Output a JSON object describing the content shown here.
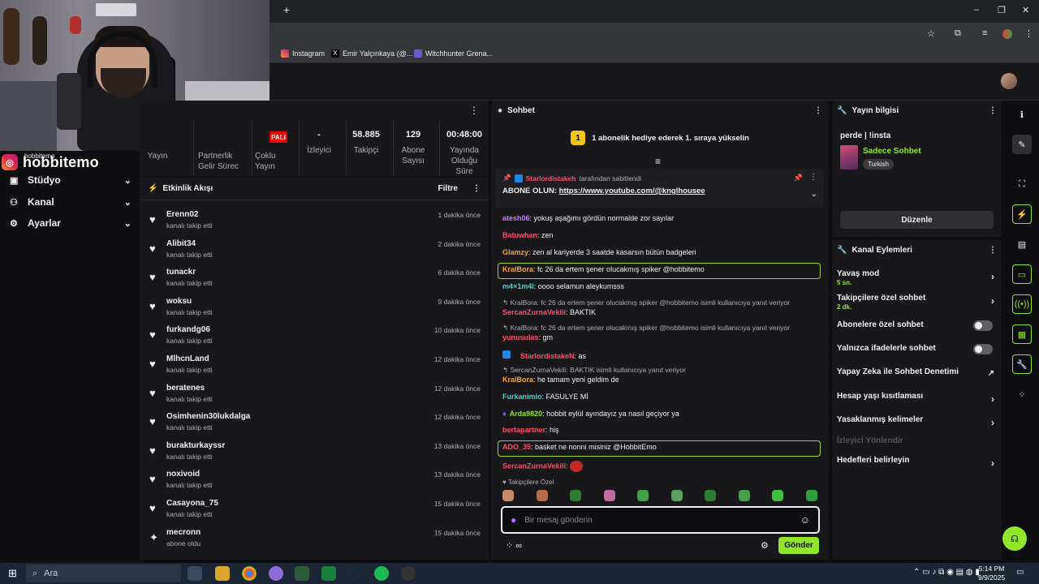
{
  "browser": {
    "new_tab": "+",
    "bookmarks": [
      "Instagram",
      "Emir Yalçınkaya (@...",
      "Witchhunter Grena..."
    ],
    "window_controls": [
      "–",
      "❐",
      "✕"
    ]
  },
  "overlay": {
    "brand_name": "hobbitemo",
    "brand_small": "hobbitemo"
  },
  "nav": {
    "items": [
      {
        "label": "Stüdyo",
        "icon": "studio-icon"
      },
      {
        "label": "Kanal",
        "icon": "channel-icon"
      },
      {
        "label": "Ayarlar",
        "icon": "settings-icon"
      }
    ]
  },
  "stats": {
    "badge": "PALI",
    "items": [
      {
        "value": "",
        "label": "Yayın"
      },
      {
        "value": "",
        "label": "Partnerlik Gelir Sürec"
      },
      {
        "value": "",
        "label": "Çoklu Yayın"
      },
      {
        "value": "-",
        "label": "İzleyici"
      },
      {
        "value": "58.885",
        "label": "Takipçi"
      },
      {
        "value": "129",
        "label": "Abone Sayısı"
      },
      {
        "value": "00:48:00",
        "label": "Yayında Olduğu Süre"
      }
    ]
  },
  "feed": {
    "title": "Etkinlik Akışı",
    "filter_label": "Filtre",
    "items": [
      {
        "user": "Erenn02",
        "action": "kanalı takip etti",
        "time": "1 dakika önce"
      },
      {
        "user": "Alibit34",
        "action": "kanalı takip etti",
        "time": "2 dakika önce"
      },
      {
        "user": "tunackr",
        "action": "kanalı takip etti",
        "time": "6 dakika önce"
      },
      {
        "user": "woksu",
        "action": "kanalı takip etti",
        "time": "9 dakika önce"
      },
      {
        "user": "furkandg06",
        "action": "kanalı takip etti",
        "time": "10 dakika önce"
      },
      {
        "user": "MlhcnLand",
        "action": "kanalı takip etti",
        "time": "12 dakika önce"
      },
      {
        "user": "beratenes",
        "action": "kanalı takip etti",
        "time": "12 dakika önce"
      },
      {
        "user": "Osimhenin30lukdalga",
        "action": "kanalı takip etti",
        "time": "12 dakika önce"
      },
      {
        "user": "burakturkayssr",
        "action": "kanalı takip etti",
        "time": "13 dakika önce"
      },
      {
        "user": "noxivoid",
        "action": "kanalı takip etti",
        "time": "13 dakika önce"
      },
      {
        "user": "Casayona_75",
        "action": "kanalı takip etti",
        "time": "15 dakika önce"
      },
      {
        "user": "mecronn",
        "action": "abone oldu",
        "time": "15 dakika önce"
      }
    ]
  },
  "chat": {
    "title": "Sohbet",
    "hype_rank": "1",
    "hype_text": "1 abonelik hediye ederek 1. sıraya yükselin",
    "pinned": {
      "user": "Starlordistakeh",
      "suffix": "tarafından sabitlendi",
      "label": "ABONE OLUN:",
      "link": "https://www.youtube.com/@knglhousee"
    },
    "messages": [
      {
        "user": "atesh06",
        "color": "#c77dff",
        "text": ": yokuş aşağımı gördün normalde zor sayılar"
      },
      {
        "user": "Batuwhan",
        "color": "#ff4d6d",
        "text": ": zen"
      },
      {
        "user": "Glamzy",
        "color": "#f4a236",
        "text": ": zen al kariyerde 3 saatde kasarsın bütün badgeleri"
      },
      {
        "user": "KralBora",
        "color": "#f4a236",
        "text": ": fc 26 da ertem şener olucakmış spiker @hobbitemo"
      },
      {
        "user": "m4×1m4l",
        "color": "#4fd1c5",
        "text": ": oooo selamun aleykumsss"
      },
      {
        "user": "SercanZurnaVekili",
        "color": "#ff4d6d",
        "text": ": BAKTIK"
      },
      {
        "user": "yunusulas",
        "color": "#ff4d6d",
        "text": ": gm"
      },
      {
        "user": "StarlordistakeN",
        "color": "#ff4d6d",
        "text": ": as"
      },
      {
        "user": "KralBora",
        "color": "#f4a236",
        "text": ": he tamam yeni geldim de"
      },
      {
        "user": "Furkanimio",
        "color": "#4fd1c5",
        "text": ": FASULYE Mİ"
      },
      {
        "user": "Arda9820",
        "color": "#91e62a",
        "text": ": hobbit eylül ayındayız ya nasıl geçiyor ya"
      },
      {
        "user": "bertapartner",
        "color": "#ff4d6d",
        "text": ": hiş"
      },
      {
        "user": "ADO_35",
        "color": "#ff4d6d",
        "text": ": basket ne nonni misiniz @HobbitEmo"
      },
      {
        "user": "SercanZurnaVekili",
        "color": "#ff4d6d",
        "text": ":"
      }
    ],
    "replies": [
      "KralBora: fc 26 da ertem şener olucakmış spiker @hobbitemo isimli kullanıcıya yanıt veriyor",
      "KralBora: fc 26 da ertem şener olucakmış spiker @hobbitemo isimli kullanıcıya yanıt veriyor",
      "SercanZurnaVekili: BAKTIK isimli kullanıcıya yanıt veriyor"
    ],
    "emote_label": "Takipçilere Özel",
    "input_placeholder": "Bir mesaj gönderin",
    "send_label": "Gönder"
  },
  "stream_info": {
    "title": "Yayın bilgisi",
    "stream_title": "perde | !insta",
    "category": "Sadece Sohbet",
    "tag": "Turkish",
    "edit_label": "Düzenle"
  },
  "channel_actions": {
    "title": "Kanal Eylemleri",
    "rows": [
      {
        "label": "Yavaş mod",
        "sub": "5 sn.",
        "control": "chevron"
      },
      {
        "label": "Takipçilere özel sohbet",
        "sub": "2 dk.",
        "control": "chevron"
      },
      {
        "label": "Abonelere özel sohbet",
        "sub": "",
        "control": "toggle"
      },
      {
        "label": "Yalnızca ifadelerle sohbet",
        "sub": "",
        "control": "toggle"
      },
      {
        "label": "Yapay Zeka ile Sohbet Denetimi",
        "sub": "",
        "control": "external"
      },
      {
        "label": "Hesap yaşı kısıtlaması",
        "sub": "",
        "control": "chevron"
      },
      {
        "label": "Yasaklanmış kelimeler",
        "sub": "",
        "control": "chevron"
      },
      {
        "label": "İzleyici Yönlendir",
        "sub": "",
        "control": "none"
      },
      {
        "label": "Hedefleri belirleyin",
        "sub": "",
        "control": "chevron"
      }
    ]
  },
  "taskbar": {
    "search_label": "Ara",
    "time": "5:14 PM",
    "date": "9/9/2025"
  },
  "colors": {
    "accent": "#91e62a",
    "background": "#0e0e10",
    "panel": "#18181b",
    "live_red": "#eb0400"
  }
}
